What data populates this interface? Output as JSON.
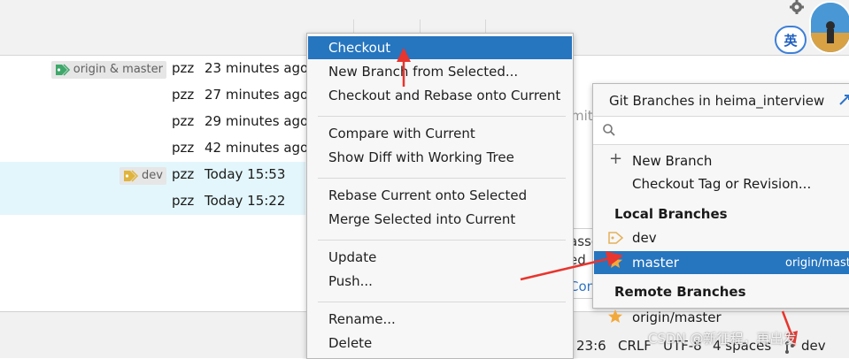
{
  "toolbar": {
    "ime_label": "英"
  },
  "commits": [
    {
      "tag": "origin & master",
      "author": "pzz",
      "date": "23 minutes ago",
      "selected": false
    },
    {
      "tag": "",
      "author": "pzz",
      "date": "27 minutes ago",
      "selected": false
    },
    {
      "tag": "",
      "author": "pzz",
      "date": "29 minutes ago",
      "selected": false
    },
    {
      "tag": "",
      "author": "pzz",
      "date": "42 minutes ago",
      "selected": false
    },
    {
      "tag": "dev",
      "author": "pzz",
      "date": "Today 15:53",
      "selected": true
    },
    {
      "tag": "",
      "author": "pzz",
      "date": "Today 15:22",
      "selected": true
    }
  ],
  "context_menu": {
    "groups": [
      [
        "Checkout",
        "New Branch from Selected...",
        "Checkout and Rebase onto Current"
      ],
      [
        "Compare with Current",
        "Show Diff with Working Tree"
      ],
      [
        "Rebase Current onto Selected",
        "Merge Selected into Current"
      ],
      [
        "Update",
        "Push..."
      ],
      [
        "Rename...",
        "Delete"
      ]
    ],
    "highlighted": "Checkout"
  },
  "behind_fragments": {
    "mit": "mit",
    "asse": "asse",
    "ed": "ed",
    "con": "Con"
  },
  "branches_popup": {
    "title": "Git Branches in heima_interview",
    "search_value": "",
    "actions": [
      "New Branch",
      "Checkout Tag or Revision..."
    ],
    "local_header": "Local Branches",
    "local": [
      {
        "name": "dev",
        "tracking": "",
        "current": false
      },
      {
        "name": "master",
        "tracking": "origin/mast",
        "current": true
      }
    ],
    "remote_header": "Remote Branches",
    "remote": [
      {
        "name": "origin/master"
      }
    ]
  },
  "status_bar": {
    "position": "23:6",
    "line_ending": "CRLF",
    "encoding": "UTF-8",
    "indent": "4 spaces",
    "branch": "dev"
  },
  "watermark": "CSDN @新征程，再出发",
  "colors": {
    "highlight": "#2675bf",
    "selected_row": "#e3f6fb",
    "annotation_arrow": "#e8352e",
    "star": "#f2a93b"
  }
}
